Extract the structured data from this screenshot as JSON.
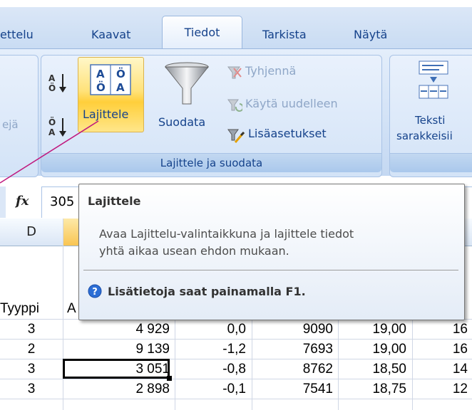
{
  "tabs": [
    {
      "label": "ettelu"
    },
    {
      "label": "Kaavat"
    },
    {
      "label": "Tiedot",
      "active": true
    },
    {
      "label": "Tarkista"
    },
    {
      "label": "Näytä"
    }
  ],
  "ribbon": {
    "left_group_partial_label": "ejä",
    "sort_group": {
      "sort_button_label": "Lajittele",
      "filter_button_label": "Suodata",
      "clear_label": "Tyhjennä",
      "reapply_label": "Käytä uudelleen",
      "advanced_label": "Lisäasetukset",
      "group_label": "Lajittele ja suodata"
    },
    "text_to_columns": {
      "line1": "Teksti",
      "line2": "sarakkeisii"
    }
  },
  "formula_bar": {
    "fx_label": "fx",
    "value_partial": "305"
  },
  "sheet": {
    "column_header_visible": "D",
    "header_row_partial": [
      "Tyyppi",
      "A"
    ],
    "rows": [
      {
        "d": "3",
        "e": "4 929",
        "f": "0,0",
        "g": "9090",
        "h": "19,00",
        "i": "16"
      },
      {
        "d": "2",
        "e": "9 139",
        "f": "-1,2",
        "g": "7693",
        "h": "19,00",
        "i": "16"
      },
      {
        "d": "3",
        "e": "3 051",
        "f": "-0,8",
        "g": "8762",
        "h": "18,50",
        "i": "14"
      },
      {
        "d": "3",
        "e": "2 898",
        "f": "-0,1",
        "g": "7541",
        "h": "18,75",
        "i": "12"
      }
    ]
  },
  "tooltip": {
    "title": "Lajittele",
    "body_line1": "Avaa Lajittelu-valintaikkuna ja lajittele tiedot",
    "body_line2": "yhtä aikaa usean ehdon mukaan.",
    "help_text": "Lisätietoja saat painamalla F1."
  },
  "colors": {
    "ribbon_text": "#15428b",
    "highlight": "#ffd455",
    "callout_line": "#c0197e",
    "help_icon": "#2c6ed5"
  }
}
